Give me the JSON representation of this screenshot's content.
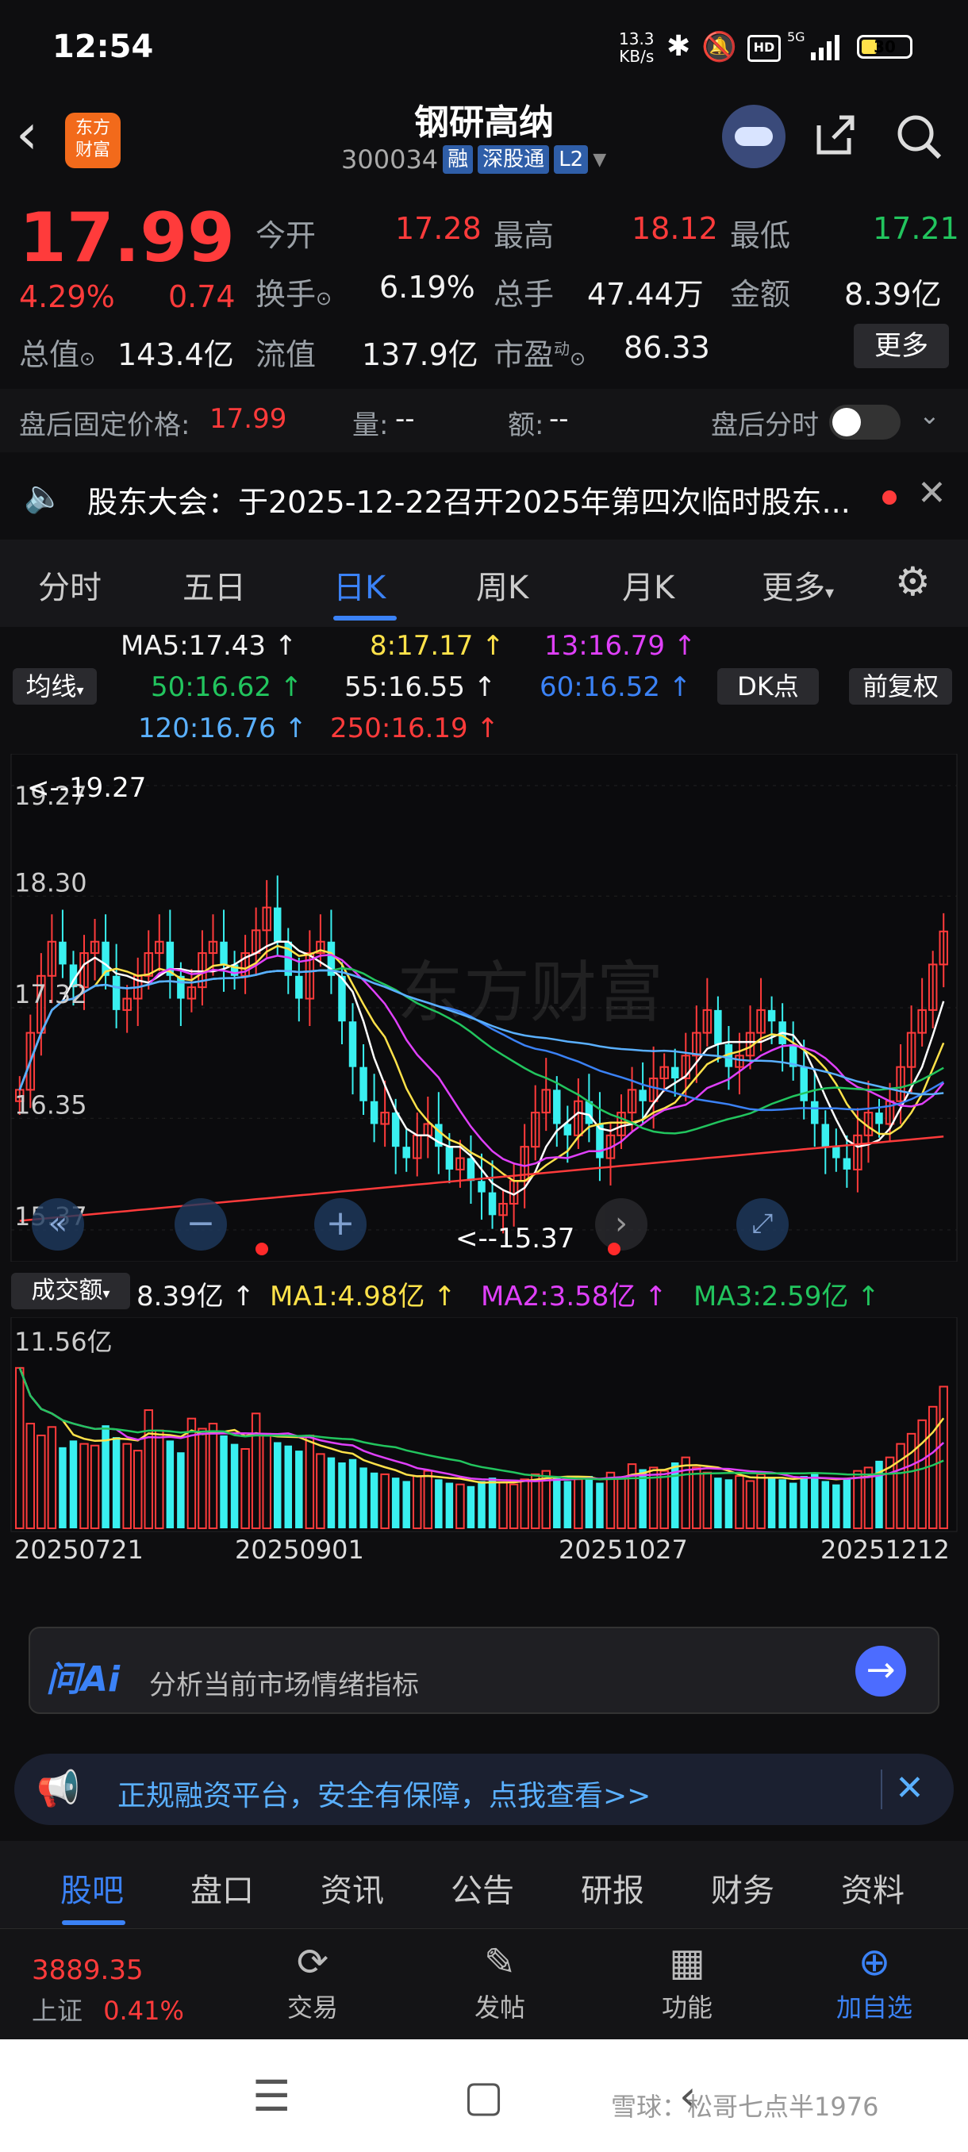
{
  "status_bar": {
    "time": "12:54",
    "net_speed": "13.3",
    "net_unit": "KB/s",
    "battery": "30"
  },
  "header": {
    "logo_text_1": "东方",
    "logo_text_2": "财富",
    "stock_name": "钢研高纳",
    "stock_code": "300034",
    "tag_rong": "融",
    "tag_sgt": "深股通",
    "tag_l2": "L2"
  },
  "quote": {
    "price": "17.99",
    "change_pct": "4.29%",
    "change_amt": "0.74",
    "open_label": "今开",
    "open": "17.28",
    "high_label": "最高",
    "high": "18.12",
    "low_label": "最低",
    "low": "17.21",
    "turnover_label": "换手",
    "turnover": "6.19%",
    "volume_label": "总手",
    "volume": "47.44万",
    "amount_label": "金额",
    "amount": "8.39亿",
    "mcap_label": "总值",
    "mcap": "143.4亿",
    "float_label": "流值",
    "float": "137.9亿",
    "pe_label": "市盈",
    "pe_sup": "动",
    "pe": "86.33",
    "more": "更多"
  },
  "after_hours": {
    "fixed_label": "盘后固定价格:",
    "fixed_price": "17.99",
    "vol_label": "量:",
    "vol": "--",
    "amt_label": "额:",
    "amt": "--",
    "intraday_label": "盘后分时"
  },
  "notice": {
    "text": "股东大会：于2025-12-22召开2025年第四次临时股东..."
  },
  "chart_tabs": [
    {
      "label": "分时"
    },
    {
      "label": "五日"
    },
    {
      "label": "日K"
    },
    {
      "label": "周K"
    },
    {
      "label": "月K"
    },
    {
      "label": "更多"
    }
  ],
  "ma_legend": {
    "ma5": "MA5:17.43 ↑",
    "ma8": "8:17.17 ↑",
    "ma13": "13:16.79 ↑",
    "ma50": "50:16.62 ↑",
    "ma55": "55:16.55 ↑",
    "ma60": "60:16.52 ↑",
    "ma120": "120:16.76 ↑",
    "ma250": "250:16.19 ↑",
    "junxian": "均线",
    "dk": "DK点",
    "fuquan": "前复权"
  },
  "colors": {
    "up": "#ff3b3b",
    "down": "#39f0f0",
    "ma5": "#ffffff",
    "ma8": "#ffe24a",
    "ma13": "#e040fb",
    "ma50": "#22c55e",
    "ma55": "#f2f2f2",
    "ma60": "#3b82f6",
    "ma120": "#5ab0ff",
    "ma250": "#ff3b3b",
    "accent": "#3b82f6"
  },
  "kline": {
    "y_labels": [
      "19.27",
      "18.30",
      "17.32",
      "16.35",
      "15.37"
    ],
    "max_marker": "<--19.27",
    "min_marker": "<--15.37",
    "watermark": "东方财富"
  },
  "volume": {
    "label": "成交额",
    "value": "8.39亿 ↑",
    "ma1": "MA1:4.98亿 ↑",
    "ma2": "MA2:3.58亿 ↑",
    "ma3": "MA3:2.59亿 ↑",
    "max_label": "11.56亿",
    "dates": [
      "20250721",
      "20250901",
      "20251027",
      "20251212"
    ]
  },
  "chart_data": {
    "type": "bar",
    "y_axis": {
      "labels": [
        19.27,
        18.3,
        17.32,
        16.35,
        15.37
      ],
      "range": [
        15.37,
        19.27
      ]
    },
    "price_range": [
      15.37,
      19.27
    ],
    "closes": [
      16.6,
      17.1,
      17.6,
      17.9,
      17.7,
      17.5,
      17.8,
      17.9,
      17.6,
      17.3,
      17.4,
      17.6,
      17.8,
      17.9,
      17.6,
      17.4,
      17.5,
      17.8,
      17.9,
      17.7,
      17.6,
      17.8,
      18.0,
      18.2,
      17.9,
      17.6,
      17.4,
      17.8,
      17.9,
      17.6,
      17.2,
      16.8,
      16.5,
      16.3,
      16.4,
      16.1,
      16.0,
      16.2,
      16.3,
      16.1,
      15.9,
      16.0,
      15.8,
      15.7,
      15.5,
      15.6,
      15.8,
      16.1,
      16.4,
      16.6,
      16.3,
      16.2,
      16.5,
      16.3,
      16.0,
      16.2,
      16.4,
      16.6,
      16.5,
      16.7,
      16.8,
      16.7,
      16.9,
      17.1,
      17.3,
      17.0,
      16.8,
      16.9,
      17.1,
      17.3,
      17.2,
      17.0,
      16.8,
      16.5,
      16.3,
      16.1,
      16.0,
      15.9,
      16.2,
      16.4,
      16.3,
      16.5,
      16.8,
      17.1,
      17.3,
      17.7,
      17.99
    ],
    "volume_max": 11.56,
    "volume_unit": "亿",
    "volumes": [
      9.5,
      6.2,
      5.5,
      6.0,
      4.8,
      5.2,
      5.0,
      4.9,
      6.1,
      5.4,
      5.0,
      4.6,
      7.0,
      5.8,
      5.2,
      4.5,
      6.5,
      5.9,
      6.2,
      5.5,
      5.0,
      4.7,
      6.8,
      5.6,
      5.1,
      4.9,
      4.6,
      5.5,
      4.4,
      4.2,
      3.9,
      4.1,
      3.6,
      3.3,
      3.2,
      3.0,
      2.8,
      3.1,
      3.4,
      2.9,
      2.7,
      2.6,
      2.5,
      2.8,
      3.0,
      2.7,
      2.6,
      2.9,
      3.2,
      3.4,
      3.0,
      2.8,
      2.9,
      3.1,
      2.7,
      3.3,
      3.0,
      3.8,
      3.5,
      3.6,
      3.4,
      3.9,
      4.2,
      3.6,
      3.3,
      3.0,
      2.9,
      3.1,
      2.8,
      3.2,
      3.0,
      2.9,
      2.7,
      3.1,
      3.3,
      2.8,
      2.6,
      2.9,
      3.4,
      3.6,
      4.0,
      4.2,
      5.0,
      5.6,
      6.4,
      7.2,
      8.39
    ],
    "volume_ma1_series": "MA1",
    "x_labels": [
      "20250721",
      "20250901",
      "20251027",
      "20251212"
    ]
  },
  "ai": {
    "logo": "问Ai",
    "placeholder": "分析当前市场情绪指标"
  },
  "ad": {
    "text": "正规融资平台，安全有保障，点我查看>>"
  },
  "sub_tabs": [
    {
      "label": "股吧"
    },
    {
      "label": "盘口"
    },
    {
      "label": "资讯"
    },
    {
      "label": "公告"
    },
    {
      "label": "研报"
    },
    {
      "label": "财务"
    },
    {
      "label": "资料"
    }
  ],
  "bottom_nav": {
    "index_value": "3889.35",
    "index_name": "上证",
    "index_change": "0.41%",
    "trade": "交易",
    "post": "发帖",
    "func": "功能",
    "add_watch": "加自选"
  },
  "system": {
    "watermark": "雪球：松哥七点半1976"
  }
}
